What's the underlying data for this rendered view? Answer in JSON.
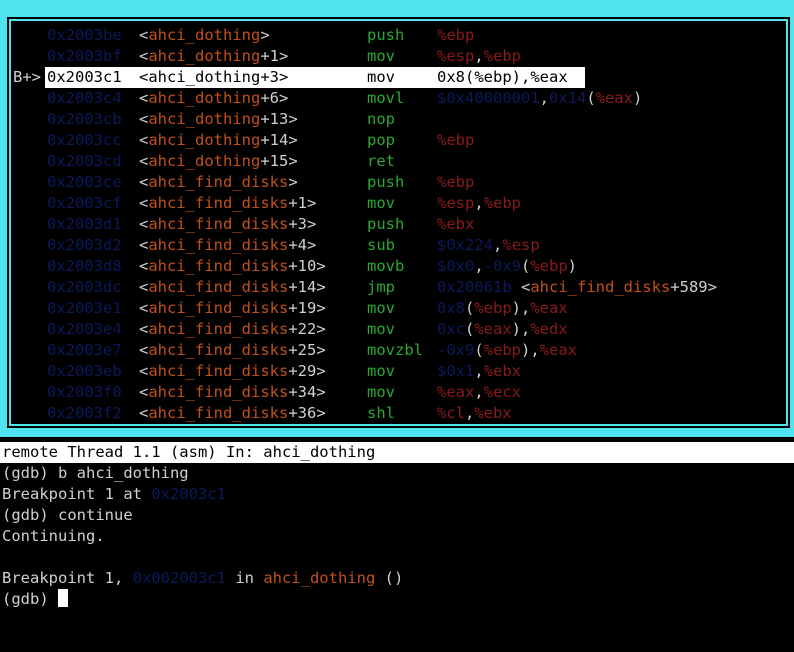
{
  "asm": {
    "lines": [
      {
        "marker": "",
        "addr": "0x2003be",
        "sym_pre": "<",
        "fn": "ahci_dothing",
        "offset": "",
        "sym_post": ">",
        "mnemonic": "push",
        "ops": [
          {
            "t": "reg",
            "v": "%ebp"
          }
        ]
      },
      {
        "marker": "",
        "addr": "0x2003bf",
        "sym_pre": "<",
        "fn": "ahci_dothing",
        "offset": "+1",
        "sym_post": ">",
        "mnemonic": "mov",
        "ops": [
          {
            "t": "reg",
            "v": "%esp"
          },
          {
            "t": "txt",
            "v": ","
          },
          {
            "t": "reg",
            "v": "%ebp"
          }
        ]
      },
      {
        "marker": "B+>",
        "addr": "0x2003c1",
        "sym_pre": "<",
        "fn": "ahci_dothing",
        "offset": "+3",
        "sym_post": ">",
        "mnemonic": "mov",
        "ops": [
          {
            "t": "txt",
            "v": "0x8(%ebp),%eax"
          }
        ],
        "current": true
      },
      {
        "marker": "",
        "addr": "0x2003c4",
        "sym_pre": "<",
        "fn": "ahci_dothing",
        "offset": "+6",
        "sym_post": ">",
        "mnemonic": "movl",
        "ops": [
          {
            "t": "imm",
            "v": "$0x40000001"
          },
          {
            "t": "txt",
            "v": ","
          },
          {
            "t": "imm",
            "v": "0x14"
          },
          {
            "t": "txt",
            "v": "("
          },
          {
            "t": "reg",
            "v": "%eax"
          },
          {
            "t": "txt",
            "v": ")"
          }
        ]
      },
      {
        "marker": "",
        "addr": "0x2003cb",
        "sym_pre": "<",
        "fn": "ahci_dothing",
        "offset": "+13",
        "sym_post": ">",
        "mnemonic": "nop",
        "ops": []
      },
      {
        "marker": "",
        "addr": "0x2003cc",
        "sym_pre": "<",
        "fn": "ahci_dothing",
        "offset": "+14",
        "sym_post": ">",
        "mnemonic": "pop",
        "ops": [
          {
            "t": "reg",
            "v": "%ebp"
          }
        ]
      },
      {
        "marker": "",
        "addr": "0x2003cd",
        "sym_pre": "<",
        "fn": "ahci_dothing",
        "offset": "+15",
        "sym_post": ">",
        "mnemonic": "ret",
        "ops": []
      },
      {
        "marker": "",
        "addr": "0x2003ce",
        "sym_pre": "<",
        "fn": "ahci_find_disks",
        "offset": "",
        "sym_post": ">",
        "mnemonic": "push",
        "ops": [
          {
            "t": "reg",
            "v": "%ebp"
          }
        ]
      },
      {
        "marker": "",
        "addr": "0x2003cf",
        "sym_pre": "<",
        "fn": "ahci_find_disks",
        "offset": "+1",
        "sym_post": ">",
        "mnemonic": "mov",
        "ops": [
          {
            "t": "reg",
            "v": "%esp"
          },
          {
            "t": "txt",
            "v": ","
          },
          {
            "t": "reg",
            "v": "%ebp"
          }
        ]
      },
      {
        "marker": "",
        "addr": "0x2003d1",
        "sym_pre": "<",
        "fn": "ahci_find_disks",
        "offset": "+3",
        "sym_post": ">",
        "mnemonic": "push",
        "ops": [
          {
            "t": "reg",
            "v": "%ebx"
          }
        ]
      },
      {
        "marker": "",
        "addr": "0x2003d2",
        "sym_pre": "<",
        "fn": "ahci_find_disks",
        "offset": "+4",
        "sym_post": ">",
        "mnemonic": "sub",
        "ops": [
          {
            "t": "imm",
            "v": "$0x224"
          },
          {
            "t": "txt",
            "v": ","
          },
          {
            "t": "reg",
            "v": "%esp"
          }
        ]
      },
      {
        "marker": "",
        "addr": "0x2003d8",
        "sym_pre": "<",
        "fn": "ahci_find_disks",
        "offset": "+10",
        "sym_post": ">",
        "mnemonic": "movb",
        "ops": [
          {
            "t": "imm",
            "v": "$0x0"
          },
          {
            "t": "txt",
            "v": ","
          },
          {
            "t": "imm",
            "v": "-0x9"
          },
          {
            "t": "txt",
            "v": "("
          },
          {
            "t": "reg",
            "v": "%ebp"
          },
          {
            "t": "txt",
            "v": ")"
          }
        ]
      },
      {
        "marker": "",
        "addr": "0x2003dc",
        "sym_pre": "<",
        "fn": "ahci_find_disks",
        "offset": "+14",
        "sym_post": ">",
        "mnemonic": "jmp",
        "ops": [
          {
            "t": "imm",
            "v": "0x20061b"
          },
          {
            "t": "txt",
            "v": " <"
          },
          {
            "t": "fn",
            "v": "ahci_find_disks"
          },
          {
            "t": "txt",
            "v": "+589>"
          }
        ]
      },
      {
        "marker": "",
        "addr": "0x2003e1",
        "sym_pre": "<",
        "fn": "ahci_find_disks",
        "offset": "+19",
        "sym_post": ">",
        "mnemonic": "mov",
        "ops": [
          {
            "t": "imm",
            "v": "0x8"
          },
          {
            "t": "txt",
            "v": "("
          },
          {
            "t": "reg",
            "v": "%ebp"
          },
          {
            "t": "txt",
            "v": "),"
          },
          {
            "t": "reg",
            "v": "%eax"
          }
        ]
      },
      {
        "marker": "",
        "addr": "0x2003e4",
        "sym_pre": "<",
        "fn": "ahci_find_disks",
        "offset": "+22",
        "sym_post": ">",
        "mnemonic": "mov",
        "ops": [
          {
            "t": "imm",
            "v": "0xc"
          },
          {
            "t": "txt",
            "v": "("
          },
          {
            "t": "reg",
            "v": "%eax"
          },
          {
            "t": "txt",
            "v": "),"
          },
          {
            "t": "reg",
            "v": "%edx"
          }
        ]
      },
      {
        "marker": "",
        "addr": "0x2003e7",
        "sym_pre": "<",
        "fn": "ahci_find_disks",
        "offset": "+25",
        "sym_post": ">",
        "mnemonic": "movzbl",
        "ops": [
          {
            "t": "imm",
            "v": "-0x9"
          },
          {
            "t": "txt",
            "v": "("
          },
          {
            "t": "reg",
            "v": "%ebp"
          },
          {
            "t": "txt",
            "v": "),"
          },
          {
            "t": "reg",
            "v": "%eax"
          }
        ]
      },
      {
        "marker": "",
        "addr": "0x2003eb",
        "sym_pre": "<",
        "fn": "ahci_find_disks",
        "offset": "+29",
        "sym_post": ">",
        "mnemonic": "mov",
        "ops": [
          {
            "t": "imm",
            "v": "$0x1"
          },
          {
            "t": "txt",
            "v": ","
          },
          {
            "t": "reg",
            "v": "%ebx"
          }
        ]
      },
      {
        "marker": "",
        "addr": "0x2003f0",
        "sym_pre": "<",
        "fn": "ahci_find_disks",
        "offset": "+34",
        "sym_post": ">",
        "mnemonic": "mov",
        "ops": [
          {
            "t": "reg",
            "v": "%eax"
          },
          {
            "t": "txt",
            "v": ","
          },
          {
            "t": "reg",
            "v": "%ecx"
          }
        ]
      },
      {
        "marker": "",
        "addr": "0x2003f2",
        "sym_pre": "<",
        "fn": "ahci_find_disks",
        "offset": "+36",
        "sym_post": ">",
        "mnemonic": "shl",
        "ops": [
          {
            "t": "reg",
            "v": "%cl"
          },
          {
            "t": "txt",
            "v": ","
          },
          {
            "t": "reg",
            "v": "%ebx"
          }
        ]
      }
    ]
  },
  "status_bar": {
    "text": "remote Thread 1.1 (asm) In: ahci_dothing"
  },
  "console": {
    "line1": "(gdb) b ahci_dothing",
    "line2_pre": "Breakpoint 1 at ",
    "line2_addr": "0x2003c1",
    "line3": "(gdb) continue",
    "line4": "Continuing.",
    "line5": "",
    "line6_pre": "Breakpoint 1, ",
    "line6_addr": "0x002003c1",
    "line6_mid": " in ",
    "line6_fn": "ahci_dothing",
    "line6_post": " ()",
    "prompt": "(gdb) "
  },
  "colors": {
    "frame": "#4fe3ee",
    "address": "#0a1a5a",
    "function": "#c0501a",
    "mnemonic": "#2aa832",
    "register": "#8b1a1a"
  }
}
